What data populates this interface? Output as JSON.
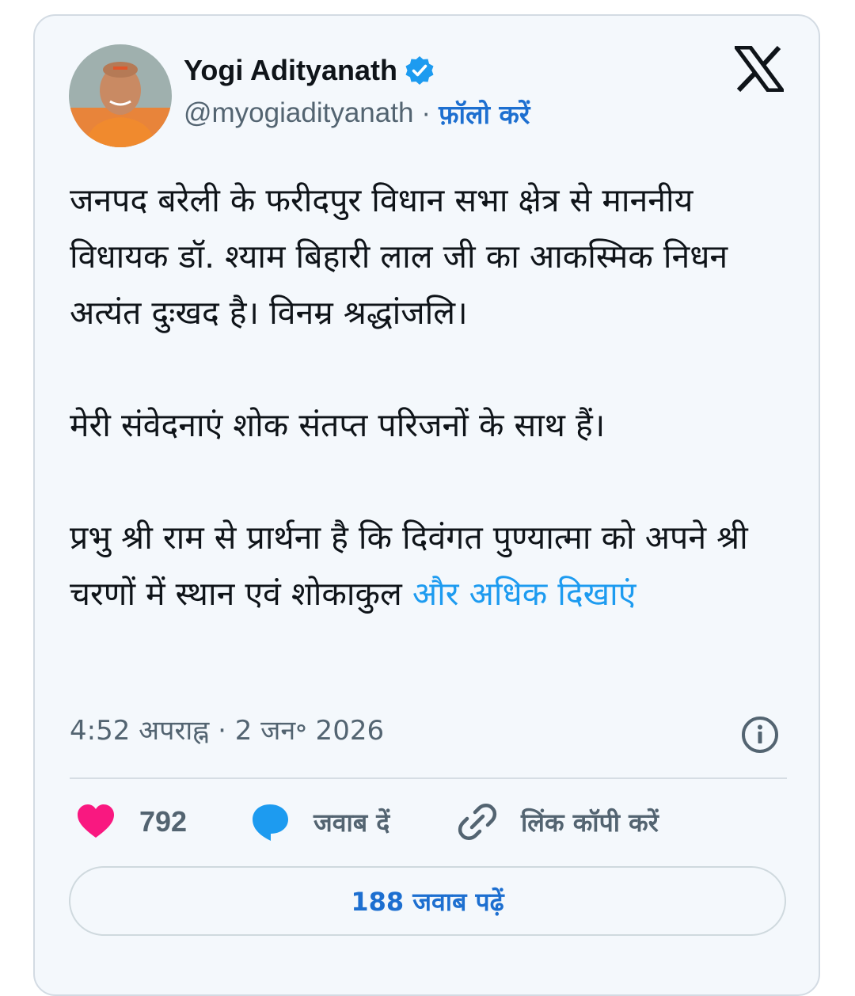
{
  "author": {
    "name": "Yogi Adityanath",
    "handle": "@myogiadityanath",
    "separator": "·",
    "follow_label": "फ़ॉलो करें",
    "verified": true
  },
  "tweet": {
    "paragraphs": [
      "जनपद बरेली के फरीदपुर विधान सभा क्षेत्र से माननीय विधायक डॉ. श्याम बिहारी लाल जी का आकस्मिक निधन अत्यंत दुःखद है। विनम्र श्रद्धांजलि।",
      "मेरी संवेदनाएं शोक संतप्त परिजनों के साथ हैं।",
      "प्रभु श्री राम से प्रार्थना है कि दिवंगत पुण्यात्मा को अपने श्री चरणों में स्थान एवं शोकाकुल"
    ],
    "show_more": "और अधिक दिखाएं",
    "timestamp": "4:52 अपराह्न · 2 जन॰ 2026"
  },
  "actions": {
    "like_count": "792",
    "reply_label": "जवाब दें",
    "copy_link_label": "लिंक कॉपी करें",
    "read_replies_label": "188 जवाब पढ़ें"
  },
  "colors": {
    "card_bg": "#f4f8fc",
    "text": "#0f1419",
    "muted": "#536471",
    "link": "#1d9bf0",
    "link_bold": "#1d6fd0",
    "like": "#f91880",
    "verified": "#1d9bf0"
  },
  "icons": {
    "verified": "verified-badge-icon",
    "brand": "x-logo-icon",
    "info": "info-icon",
    "like": "heart-icon",
    "reply": "speech-bubble-icon",
    "copy": "link-icon"
  }
}
